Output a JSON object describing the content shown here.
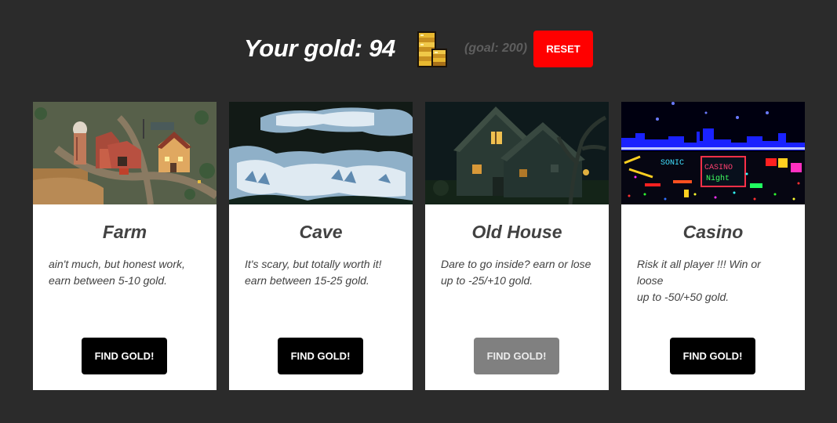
{
  "header": {
    "gold_text": "Your gold: 94",
    "gold_value": 94,
    "coin_icon": "gold-coins-stack-icon",
    "goal_text": "(goal: 200)",
    "reset_label": "RESET"
  },
  "colors": {
    "background": "#2b2b2b",
    "reset": "#ff0000",
    "button": "#000000",
    "button_disabled": "#808080",
    "card": "#ffffff"
  },
  "locations": [
    {
      "title": "Farm",
      "desc_line1": "ain't much, but honest work,",
      "desc_line2": "earn between 5-10 gold.",
      "button_label": "FIND GOLD!",
      "button_disabled": false,
      "image": "pixel-art-farm"
    },
    {
      "title": "Cave",
      "desc_line1": "It's scary, but totally worth it!",
      "desc_line2": "earn between 15-25 gold.",
      "button_label": "FIND GOLD!",
      "button_disabled": false,
      "image": "pixel-art-cave"
    },
    {
      "title": "Old House",
      "desc_line1": "Dare to go inside? earn or lose",
      "desc_line2": "up to -25/+10 gold.",
      "button_label": "FIND GOLD!",
      "button_disabled": true,
      "image": "pixel-art-haunted-house"
    },
    {
      "title": "Casino",
      "desc_line1": "Risk it all player !!! Win or loose",
      "desc_line2": "up to -50/+50 gold.",
      "button_label": "FIND GOLD!",
      "button_disabled": false,
      "image": "pixel-art-casino-night",
      "sign_text": [
        "SONIC",
        "CASINO",
        "Night"
      ]
    }
  ]
}
